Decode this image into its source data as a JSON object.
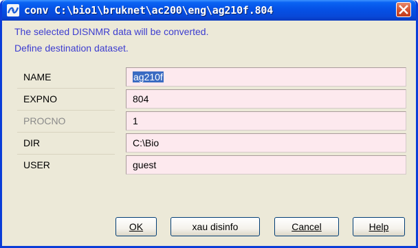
{
  "window": {
    "title": "conv C:\\bio1\\bruknet\\ac200\\eng\\ag210f.804",
    "app_icon": "bruker-logo-icon",
    "close_icon": "close-icon"
  },
  "message": {
    "line1": "The selected DISNMR data will be converted.",
    "line2": "Define destination dataset."
  },
  "form": {
    "rows": [
      {
        "label": "NAME",
        "value": "ag210f",
        "selected": true,
        "enabled": true
      },
      {
        "label": "EXPNO",
        "value": "804",
        "selected": false,
        "enabled": true
      },
      {
        "label": "PROCNO",
        "value": "1",
        "selected": false,
        "enabled": false
      },
      {
        "label": "DIR",
        "value": "C:\\Bio",
        "selected": false,
        "enabled": true
      },
      {
        "label": "USER",
        "value": "guest",
        "selected": false,
        "enabled": true
      }
    ]
  },
  "buttons": {
    "ok_label": "OK",
    "xau_label": "xau disinfo",
    "cancel_label": "Cancel",
    "help_label": "Help"
  },
  "colors": {
    "titlebar": "#0551e6",
    "field_bg": "#fde9ee",
    "message_text": "#3c3cd0",
    "dialog_bg": "#ece9d8"
  }
}
